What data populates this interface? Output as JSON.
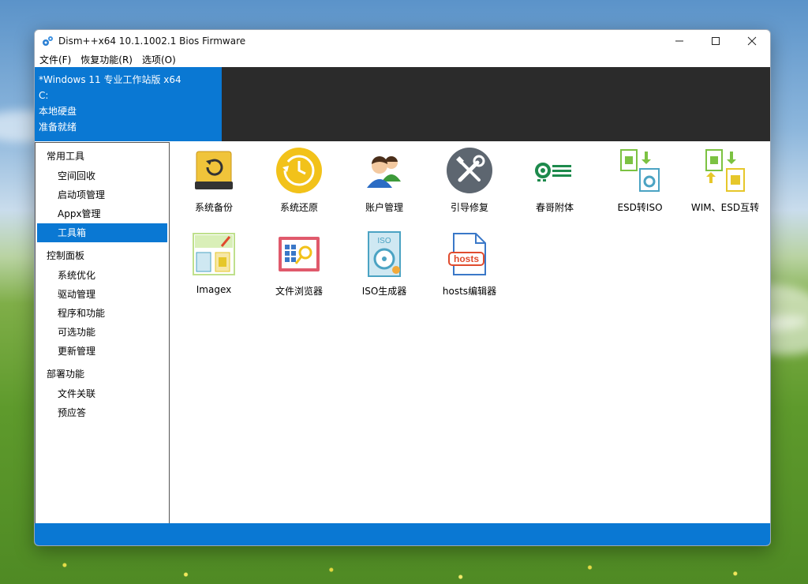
{
  "window": {
    "title": "Dism++x64 10.1.1002.1 Bios Firmware",
    "controls": {
      "minimize": "—",
      "maximize": "☐",
      "close": "✕"
    }
  },
  "menu": [
    "文件(F)",
    "恢复功能(R)",
    "选项(O)"
  ],
  "info": {
    "os": "*Windows 11 专业工作站版 x64",
    "drive": "C:",
    "disk": "本地硬盘",
    "status": "准备就绪"
  },
  "sidebar": {
    "groups": [
      {
        "title": "常用工具",
        "items": [
          "空间回收",
          "启动项管理",
          "Appx管理",
          "工具箱"
        ]
      },
      {
        "title": "控制面板",
        "items": [
          "系统优化",
          "驱动管理",
          "程序和功能",
          "可选功能",
          "更新管理"
        ]
      },
      {
        "title": "部署功能",
        "items": [
          "文件关联",
          "预应答"
        ]
      }
    ],
    "active": "工具箱"
  },
  "tools": [
    {
      "label": "系统备份",
      "icon": "backup-drive-icon"
    },
    {
      "label": "系统还原",
      "icon": "restore-clock-icon"
    },
    {
      "label": "账户管理",
      "icon": "users-icon"
    },
    {
      "label": "引导修复",
      "icon": "tools-repair-icon"
    },
    {
      "label": "春哥附体",
      "icon": "settings-toggle-icon"
    },
    {
      "label": "ESD转ISO",
      "icon": "esd-to-iso-icon"
    },
    {
      "label": "WIM、ESD互转",
      "icon": "wim-esd-convert-icon"
    },
    {
      "label": "Imagex",
      "icon": "imagex-icon"
    },
    {
      "label": "文件浏览器",
      "icon": "file-browser-icon"
    },
    {
      "label": "ISO生成器",
      "icon": "iso-generator-icon"
    },
    {
      "label": "hosts编辑器",
      "icon": "hosts-editor-icon",
      "icon_text": "hosts"
    }
  ],
  "colors": {
    "accent": "#0a78d3",
    "info_bg": "#2b2b2b"
  }
}
